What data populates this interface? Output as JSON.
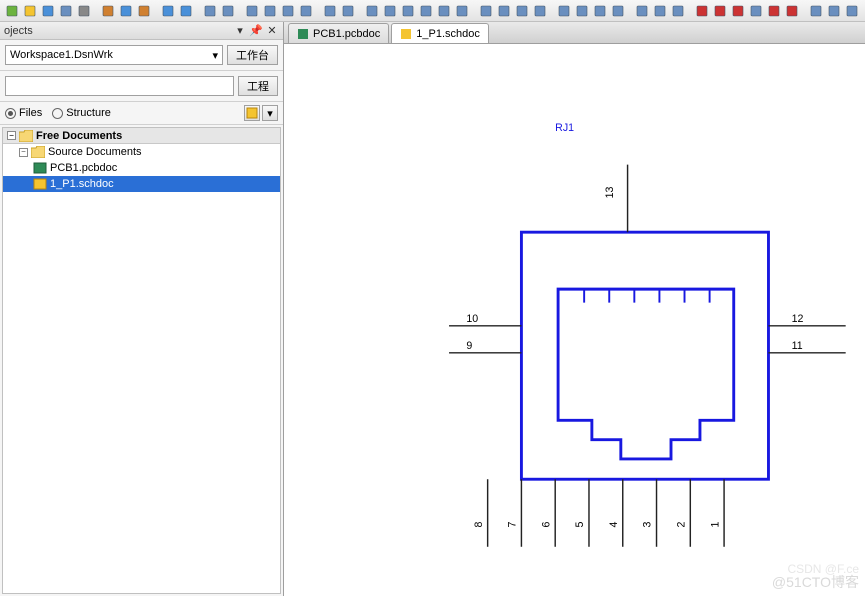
{
  "toolbar_icons": [
    "new",
    "open",
    "save",
    "save-all",
    "print",
    "sep",
    "cut",
    "copy",
    "paste",
    "sep",
    "undo",
    "redo",
    "sep",
    "select",
    "move",
    "sep",
    "zoom-window",
    "zoom-fit",
    "zoom-in",
    "zoom-out",
    "sep",
    "grid",
    "snap",
    "sep",
    "align-left",
    "align-right",
    "align-top",
    "align-bottom",
    "distribute-h",
    "distribute-v",
    "sep",
    "rotate-left",
    "rotate-right",
    "flip-h",
    "flip-v",
    "sep",
    "layer-up",
    "layer-down",
    "group",
    "ungroup",
    "sep",
    "measure",
    "drc",
    "compile",
    "sep",
    "net",
    "wire",
    "bus",
    "port",
    "power",
    "gnd",
    "sep",
    "annotate",
    "cross-probe",
    "highlight",
    "sep",
    "pen-color"
  ],
  "sidebar": {
    "panel_title": "ojects",
    "workspace": "Workspace1.DsnWrk",
    "btn_workspace": "工作台",
    "btn_project": "工程",
    "radio_files": "Files",
    "radio_structure": "Structure",
    "tree": {
      "cat": "Free Documents",
      "folder": "Source Documents",
      "doc1": "PCB1.pcbdoc",
      "doc2": "1_P1.schdoc"
    }
  },
  "tabs": {
    "t1": "PCB1.pcbdoc",
    "t2": "1_P1.schdoc"
  },
  "schematic": {
    "designator": "RJ1",
    "pins_bottom": [
      "8",
      "7",
      "6",
      "5",
      "4",
      "3",
      "2",
      "1"
    ],
    "pins_left": [
      "10",
      "9"
    ],
    "pins_right": [
      "12",
      "11"
    ],
    "pin_top": "13"
  },
  "watermark1": "@51CTO博客",
  "watermark2": "CSDN @F.ce"
}
